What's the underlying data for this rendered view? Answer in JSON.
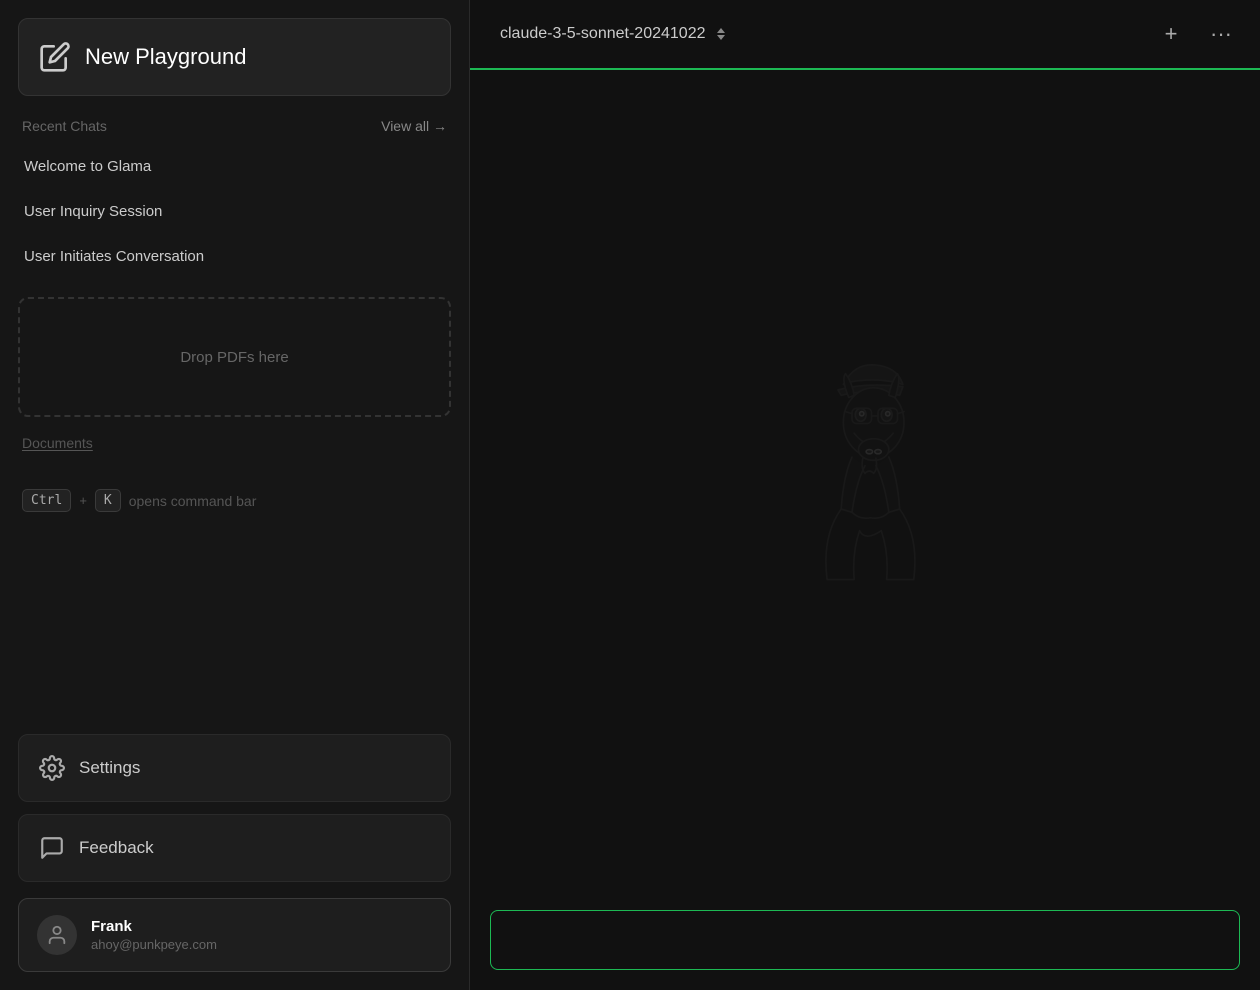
{
  "sidebar": {
    "new_playground_label": "New Playground",
    "recent_chats_label": "Recent Chats",
    "view_all_label": "View all →",
    "chats": [
      {
        "title": "Welcome to Glama"
      },
      {
        "title": "User Inquiry Session"
      },
      {
        "title": "User Initiates Conversation"
      }
    ],
    "drop_zone_label": "Drop PDFs here",
    "documents_label": "Documents",
    "keyboard_hint": {
      "ctrl": "Ctrl",
      "plus": "+",
      "k": "K",
      "description": "opens command bar"
    },
    "settings_label": "Settings",
    "feedback_label": "Feedback",
    "user": {
      "name": "Frank",
      "email": "ahoy@punkpeye.com"
    }
  },
  "main": {
    "model_name": "claude-3-5-sonnet-20241022",
    "add_button_label": "+",
    "more_button_label": "···",
    "input_placeholder": ""
  },
  "accent_color": "#1db954"
}
